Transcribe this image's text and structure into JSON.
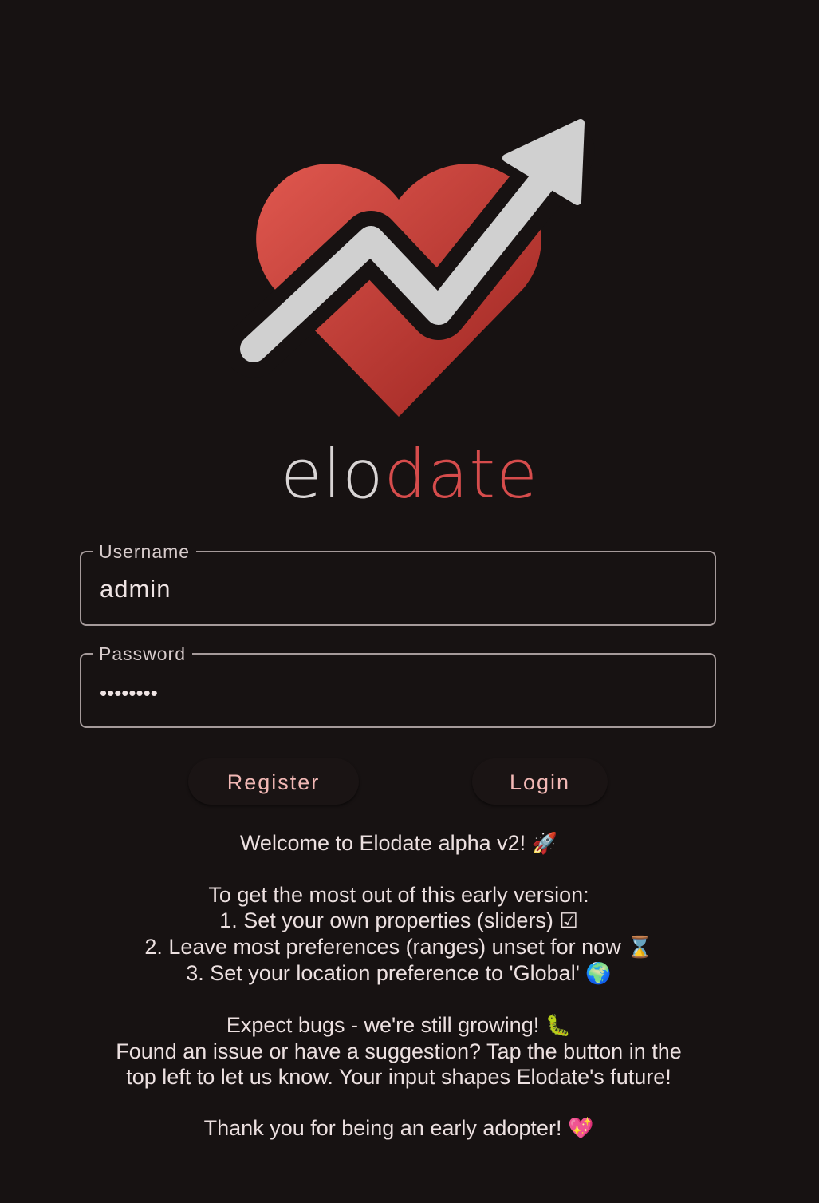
{
  "app": {
    "wordmark_part1": "elo",
    "wordmark_part2": "date"
  },
  "form": {
    "username_label": "Username",
    "username_value": "admin",
    "password_label": "Password",
    "password_value": "••••••••"
  },
  "buttons": {
    "register": "Register",
    "login": "Login"
  },
  "message": {
    "line1": "Welcome to Elodate alpha v2!",
    "line1_emoji": "🚀",
    "line2": "To get the most out of this early version:",
    "line3": "1. Set your own properties (sliders)",
    "line3_emoji": "☑",
    "line4": "2. Leave most preferences (ranges) unset for now",
    "line4_emoji": "⌛",
    "line5": "3. Set your location preference to 'Global'",
    "line5_emoji": "🌍",
    "line6": "Expect bugs - we're still growing!",
    "line6_emoji": "🐛",
    "line7": "Found an issue or have a suggestion? Tap the button in the",
    "line8": "top left to let us know. Your input shapes Elodate's future!",
    "line9": "Thank you for being an early adopter!",
    "line9_emoji": "💖"
  },
  "colors": {
    "background": "#171212",
    "heart": "#c43c36",
    "arrow": "#d0d0d0",
    "accent_text": "#f2b8b5",
    "field_border": "#a59a9a"
  }
}
